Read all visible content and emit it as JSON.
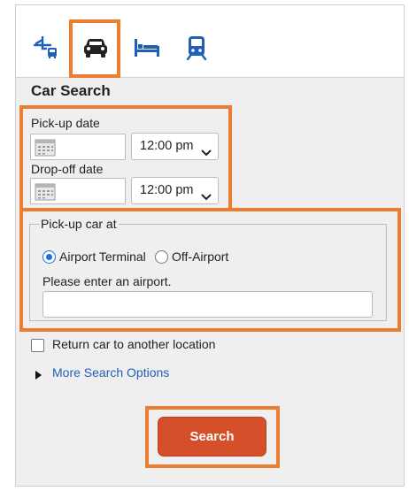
{
  "tabs": [
    {
      "id": "flights",
      "icon": "flight-hotel-icon",
      "active": false
    },
    {
      "id": "cars",
      "icon": "car-icon",
      "active": true
    },
    {
      "id": "hotels",
      "icon": "bed-icon",
      "active": false
    },
    {
      "id": "rail",
      "icon": "train-icon",
      "active": false
    }
  ],
  "section_title": "Car Search",
  "pickup": {
    "label": "Pick-up date",
    "date_value": "",
    "time_value": "12:00 pm"
  },
  "dropoff": {
    "label": "Drop-off date",
    "date_value": "",
    "time_value": "12:00 pm"
  },
  "location": {
    "legend": "Pick-up car at",
    "options": [
      {
        "label": "Airport Terminal",
        "selected": true
      },
      {
        "label": "Off-Airport",
        "selected": false
      }
    ],
    "airport_label": "Please enter an airport.",
    "airport_value": ""
  },
  "return_elsewhere": {
    "label": "Return car to another location",
    "checked": false
  },
  "more_options_label": "More Search Options",
  "search_button_label": "Search",
  "colors": {
    "accent": "#ec7d31",
    "button": "#d5502a",
    "link": "#1f5fb8",
    "icon": "#1f5fb8"
  }
}
